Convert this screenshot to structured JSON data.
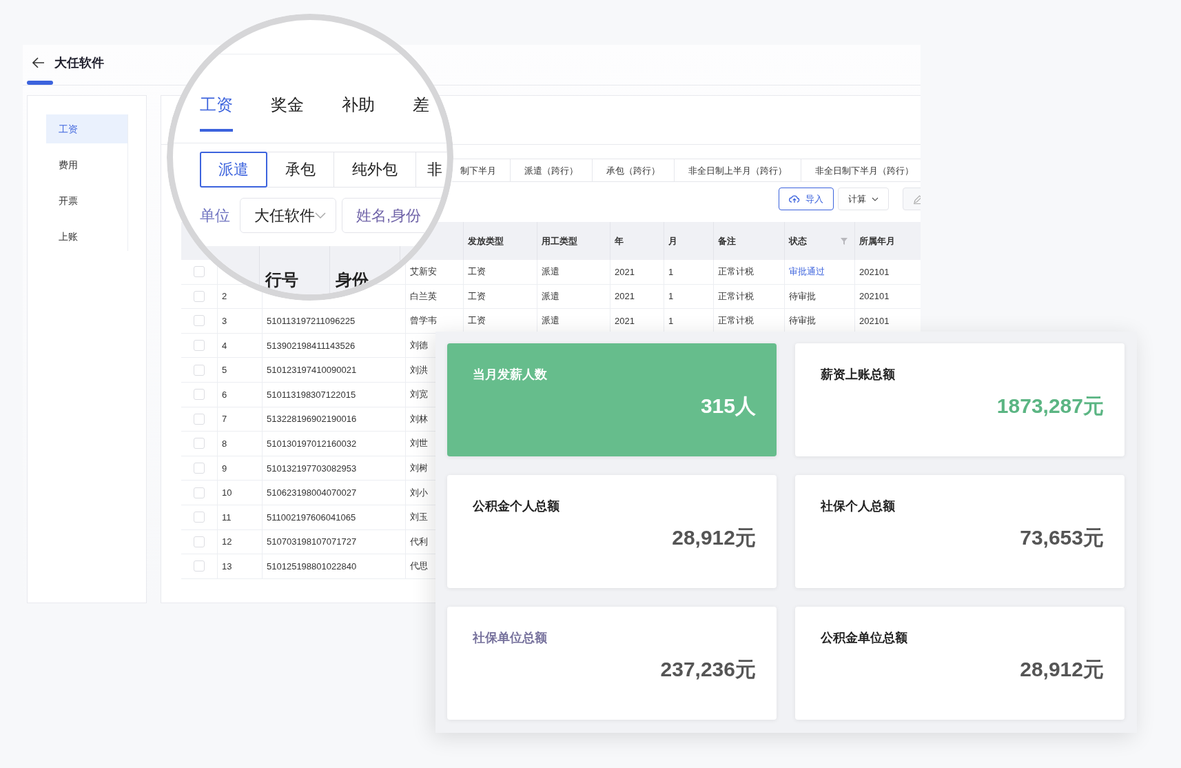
{
  "header": {
    "title": "大任软件"
  },
  "sidebar": {
    "items": [
      {
        "label": "工资",
        "selected": true
      },
      {
        "label": "费用",
        "selected": false
      },
      {
        "label": "开票",
        "selected": false
      },
      {
        "label": "上账",
        "selected": false
      }
    ]
  },
  "magnifier": {
    "tabs": [
      {
        "label": "工资",
        "selected": true
      },
      {
        "label": "奖金",
        "selected": false
      },
      {
        "label": "补助",
        "selected": false
      },
      {
        "label": "差",
        "selected": false
      }
    ],
    "sub_tabs": [
      {
        "label": "派遣",
        "selected": true
      },
      {
        "label": "承包",
        "selected": false
      },
      {
        "label": "纯外包",
        "selected": false
      },
      {
        "label": "非",
        "selected": false
      }
    ],
    "filter": {
      "label": "单位",
      "select_value": "大任软件",
      "search_placeholder": "姓名,身份"
    },
    "table_headers": [
      "行号",
      "身份"
    ]
  },
  "sub_tabs": [
    {
      "label": "制下半月",
      "selected": false
    },
    {
      "label": "派遣（跨行）",
      "selected": false
    },
    {
      "label": "承包（跨行）",
      "selected": false
    },
    {
      "label": "非全日制上半月（跨行）",
      "selected": false
    },
    {
      "label": "非全日制下半月（跨行）",
      "selected": false
    }
  ],
  "toolbar": {
    "buttons": [
      {
        "kind": "import",
        "label": "导入"
      },
      {
        "kind": "dropdown",
        "label": "计算"
      },
      {
        "kind": "edit"
      }
    ]
  },
  "table": {
    "columns": [
      {
        "label": "发放类型",
        "filterable": false
      },
      {
        "label": "用工类型",
        "filterable": false
      },
      {
        "label": "年",
        "filterable": false
      },
      {
        "label": "月",
        "filterable": false
      },
      {
        "label": "备注",
        "filterable": false
      },
      {
        "label": "状态",
        "filterable": true
      },
      {
        "label": "所属年月",
        "filterable": false
      }
    ],
    "rows": [
      {
        "checked": false,
        "name": "艾新安",
        "pay_type": "工资",
        "work_type": "派遣",
        "year": "2021",
        "month": "1",
        "note": "正常计税",
        "status": "审批通过",
        "approved": true,
        "period": "202101"
      },
      {
        "checked": false,
        "no": "2",
        "name": "白兰英",
        "pay_type": "工资",
        "work_type": "派遣",
        "year": "2021",
        "month": "1",
        "note": "正常计税",
        "status": "待审批",
        "approved": false,
        "period": "202101"
      },
      {
        "checked": false,
        "no": "3",
        "id": "510113197211096225",
        "name": "曾学韦",
        "pay_type": "工资",
        "work_type": "派遣",
        "year": "2021",
        "month": "1",
        "note": "正常计税",
        "status": "待审批",
        "approved": false,
        "period": "202101"
      },
      {
        "checked": false,
        "no": "4",
        "id": "513902198411143526",
        "name": "刘德"
      },
      {
        "checked": false,
        "no": "5",
        "id": "510123197410090021",
        "name": "刘洪"
      },
      {
        "checked": false,
        "no": "6",
        "id": "510113198307122015",
        "name": "刘宽"
      },
      {
        "checked": false,
        "no": "7",
        "id": "513228196902190016",
        "name": "刘林"
      },
      {
        "checked": false,
        "no": "8",
        "id": "510130197012160032",
        "name": "刘世"
      },
      {
        "checked": false,
        "no": "9",
        "id": "510132197703082953",
        "name": "刘树"
      },
      {
        "checked": false,
        "no": "10",
        "id": "510623198004070027",
        "name": "刘小"
      },
      {
        "checked": false,
        "no": "11",
        "id": "511002197606041065",
        "name": "刘玉"
      },
      {
        "checked": false,
        "no": "12",
        "id": "510703198107071727",
        "name": "代利"
      },
      {
        "checked": false,
        "no": "13",
        "id": "510125198801022840",
        "name": "代思"
      }
    ]
  },
  "stats": [
    {
      "kind": "filled",
      "title": "当月发薪人数",
      "value": "315人"
    },
    {
      "kind": "green_value",
      "title": "薪资上账总额",
      "value": "1873,287元"
    },
    {
      "kind": "plain",
      "title": "公积金个人总额",
      "value": "28,912元"
    },
    {
      "kind": "plain",
      "title": "社保个人总额",
      "value": "73,653元"
    },
    {
      "kind": "muted_title",
      "title": "社保单位总额",
      "value": "237,236元"
    },
    {
      "kind": "plain",
      "title": "公积金单位总额",
      "value": "28,912元"
    }
  ]
}
